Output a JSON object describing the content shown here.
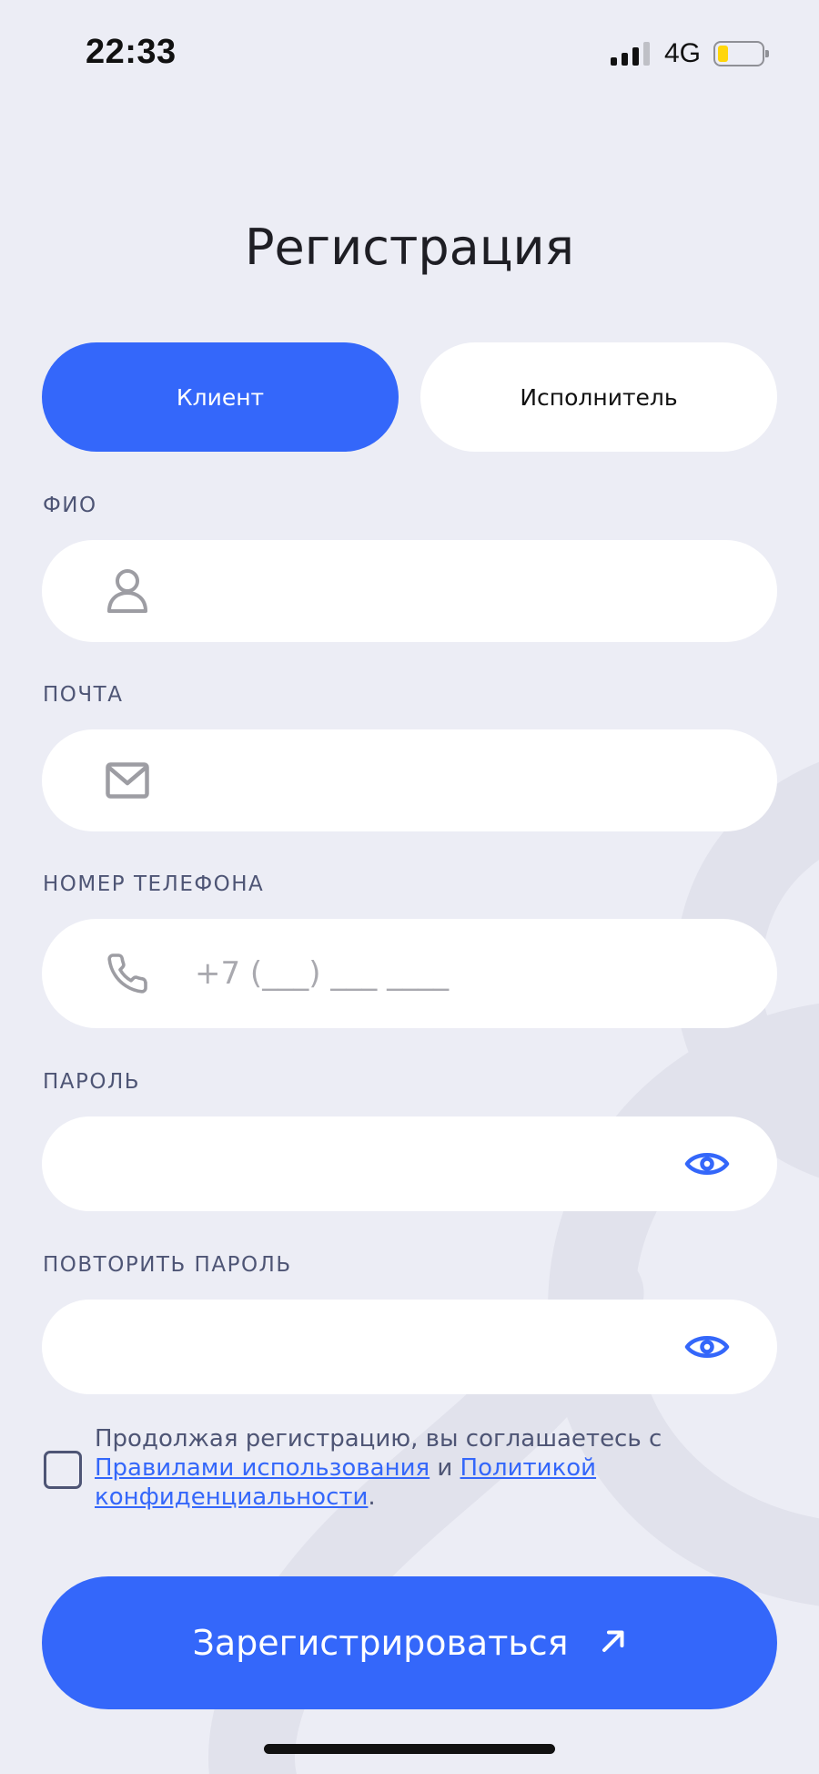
{
  "status_bar": {
    "time": "22:33",
    "network": "4G",
    "battery_level": 0.15
  },
  "title": "Регистрация",
  "role_tabs": [
    {
      "label": "Клиент",
      "active": true
    },
    {
      "label": "Исполнитель",
      "active": false
    }
  ],
  "fields": {
    "full_name": {
      "label": "ФИО",
      "icon": "user-icon",
      "value": "",
      "placeholder": ""
    },
    "email": {
      "label": "ПОЧТА",
      "icon": "mail-icon",
      "value": "",
      "placeholder": ""
    },
    "phone": {
      "label": "НОМЕР ТЕЛЕФОНА",
      "icon": "phone-icon",
      "value": "",
      "placeholder": "+7 (___) ___ ____"
    },
    "password": {
      "label": "ПАРОЛЬ",
      "icon": "eye-icon",
      "value": ""
    },
    "password_repeat": {
      "label": "ПОВТОРИТЬ ПАРОЛЬ",
      "icon": "eye-icon",
      "value": ""
    }
  },
  "agreement": {
    "checked": false,
    "text_before": "Продолжая регистрацию, вы соглашаетесь с ",
    "terms_link": "Правилами использования",
    "conjunction": " и ",
    "privacy_link": "Политикой конфиденциальности",
    "text_after": "."
  },
  "submit": {
    "label": "Зарегистрироваться",
    "icon": "arrow-up-right-icon"
  },
  "colors": {
    "accent": "#3467FA",
    "background": "#ECEDF5",
    "label": "#4E5575",
    "field": "#FFFFFF",
    "title": "#1E1E24"
  }
}
